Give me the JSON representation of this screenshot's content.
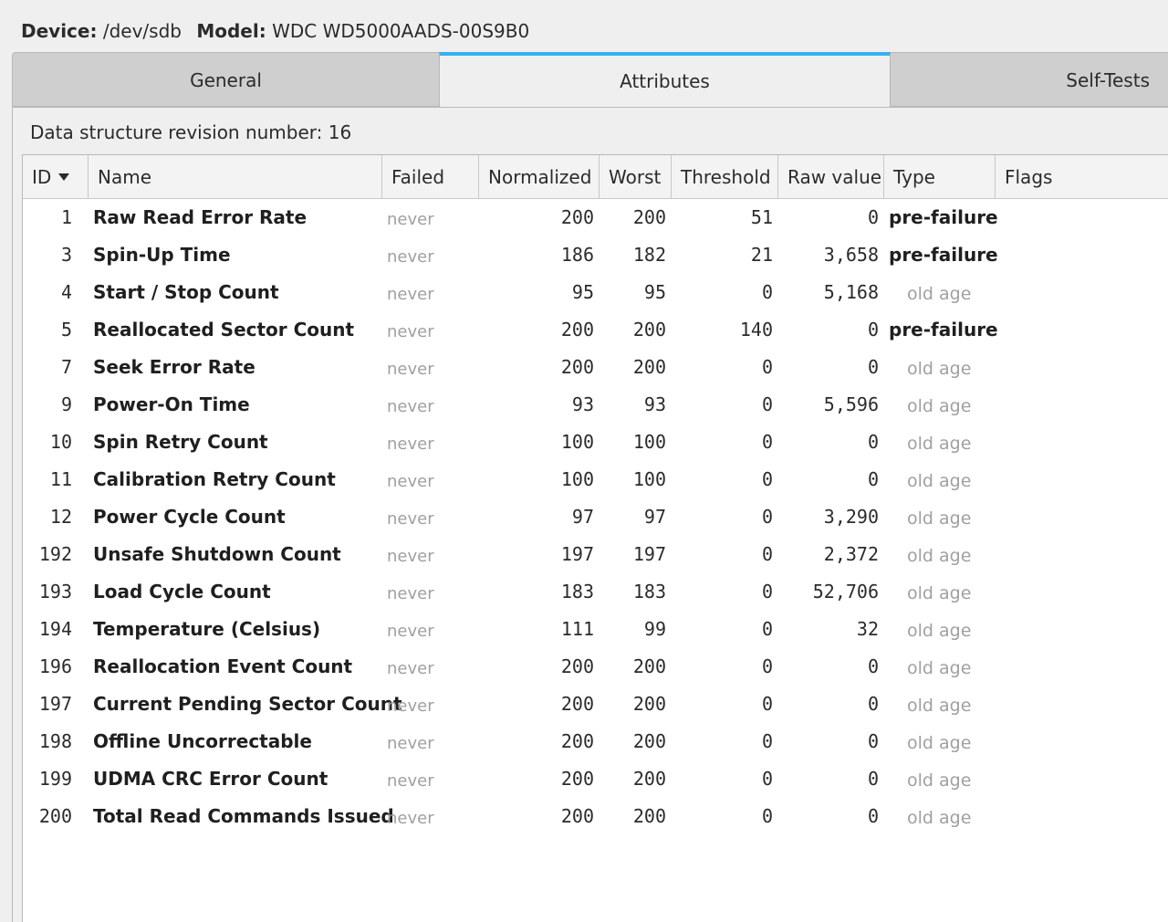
{
  "header": {
    "device_label": "Device:",
    "device_value": "/dev/sdb",
    "model_label": "Model:",
    "model_value": "WDC WD5000AADS-00S9B0"
  },
  "tabs": {
    "general": "General",
    "attributes": "Attributes",
    "self_tests": "Self-Tests",
    "active": "attributes"
  },
  "panel": {
    "revision_line": "Data structure revision number: 16"
  },
  "columns": {
    "id": "ID",
    "name": "Name",
    "failed": "Failed",
    "normalized": "Normalized",
    "worst": "Worst",
    "threshold": "Threshold",
    "raw": "Raw value",
    "type": "Type",
    "flags": "Flags"
  },
  "colors": {
    "accent": "#3daee9",
    "muted_text": "#a0a0a0"
  },
  "attributes": [
    {
      "id": "1",
      "name": "Raw Read Error Rate",
      "failed": "never",
      "normalized": "200",
      "worst": "200",
      "threshold": "51",
      "raw": "0",
      "type": "pre-failure"
    },
    {
      "id": "3",
      "name": "Spin-Up Time",
      "failed": "never",
      "normalized": "186",
      "worst": "182",
      "threshold": "21",
      "raw": "3,658",
      "type": "pre-failure"
    },
    {
      "id": "4",
      "name": "Start / Stop Count",
      "failed": "never",
      "normalized": "95",
      "worst": "95",
      "threshold": "0",
      "raw": "5,168",
      "type": "old age"
    },
    {
      "id": "5",
      "name": "Reallocated Sector Count",
      "failed": "never",
      "normalized": "200",
      "worst": "200",
      "threshold": "140",
      "raw": "0",
      "type": "pre-failure"
    },
    {
      "id": "7",
      "name": "Seek Error Rate",
      "failed": "never",
      "normalized": "200",
      "worst": "200",
      "threshold": "0",
      "raw": "0",
      "type": "old age"
    },
    {
      "id": "9",
      "name": "Power-On Time",
      "failed": "never",
      "normalized": "93",
      "worst": "93",
      "threshold": "0",
      "raw": "5,596",
      "type": "old age"
    },
    {
      "id": "10",
      "name": "Spin Retry Count",
      "failed": "never",
      "normalized": "100",
      "worst": "100",
      "threshold": "0",
      "raw": "0",
      "type": "old age"
    },
    {
      "id": "11",
      "name": "Calibration Retry Count",
      "failed": "never",
      "normalized": "100",
      "worst": "100",
      "threshold": "0",
      "raw": "0",
      "type": "old age"
    },
    {
      "id": "12",
      "name": "Power Cycle Count",
      "failed": "never",
      "normalized": "97",
      "worst": "97",
      "threshold": "0",
      "raw": "3,290",
      "type": "old age"
    },
    {
      "id": "192",
      "name": "Unsafe Shutdown Count",
      "failed": "never",
      "normalized": "197",
      "worst": "197",
      "threshold": "0",
      "raw": "2,372",
      "type": "old age"
    },
    {
      "id": "193",
      "name": "Load Cycle Count",
      "failed": "never",
      "normalized": "183",
      "worst": "183",
      "threshold": "0",
      "raw": "52,706",
      "type": "old age"
    },
    {
      "id": "194",
      "name": "Temperature (Celsius)",
      "failed": "never",
      "normalized": "111",
      "worst": "99",
      "threshold": "0",
      "raw": "32",
      "type": "old age"
    },
    {
      "id": "196",
      "name": "Reallocation Event Count",
      "failed": "never",
      "normalized": "200",
      "worst": "200",
      "threshold": "0",
      "raw": "0",
      "type": "old age"
    },
    {
      "id": "197",
      "name": "Current Pending Sector Count",
      "failed": "never",
      "normalized": "200",
      "worst": "200",
      "threshold": "0",
      "raw": "0",
      "type": "old age"
    },
    {
      "id": "198",
      "name": "Offline Uncorrectable",
      "failed": "never",
      "normalized": "200",
      "worst": "200",
      "threshold": "0",
      "raw": "0",
      "type": "old age"
    },
    {
      "id": "199",
      "name": "UDMA CRC Error Count",
      "failed": "never",
      "normalized": "200",
      "worst": "200",
      "threshold": "0",
      "raw": "0",
      "type": "old age"
    },
    {
      "id": "200",
      "name": "Total Read Commands Issued",
      "failed": "never",
      "normalized": "200",
      "worst": "200",
      "threshold": "0",
      "raw": "0",
      "type": "old age"
    }
  ]
}
